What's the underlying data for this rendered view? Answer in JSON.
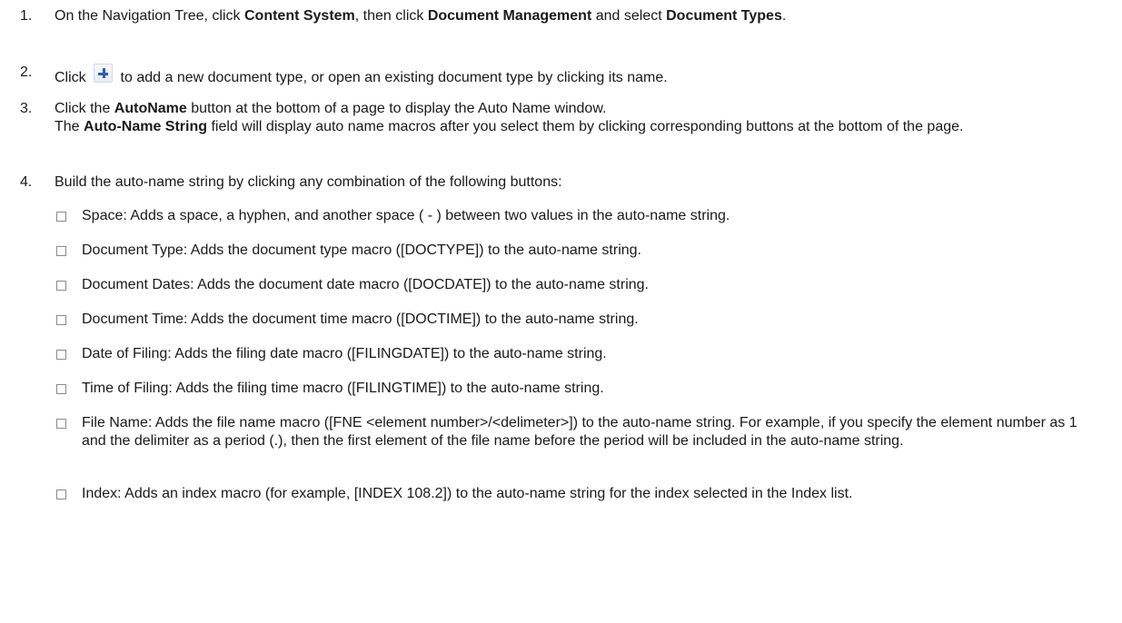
{
  "steps": [
    {
      "num": "1.",
      "t1": "On the Navigation Tree, click ",
      "b1": "Content System",
      "t2": ", then click ",
      "b2": "Document Management",
      "t3": " and select ",
      "b3": "Document Types",
      "t4": "."
    },
    {
      "num": "2.",
      "pre": "Click ",
      "icon": "plus-icon",
      "post": " to add a new document type, or open an existing document type by clicking its name."
    },
    {
      "num": "3.",
      "l1a": "Click the ",
      "l1b": "AutoName",
      "l1c": " button at the bottom of a page to display the Auto Name window.",
      "l2a": "The ",
      "l2b": "Auto-Name String",
      "l2c": " field will display auto name macros after you select them by clicking corresponding buttons at the bottom of the page."
    },
    {
      "num": "4.",
      "text": "Build the auto-name string by clicking any combination of the following buttons:"
    }
  ],
  "options": [
    "Space: Adds a space, a hyphen, and another space ( - ) between two values in the auto-name string.",
    "Document Type: Adds the document type macro ([DOCTYPE]) to the auto-name string.",
    "Document Dates: Adds the document date macro ([DOCDATE]) to the auto-name string.",
    "Document Time: Adds the document time macro ([DOCTIME]) to the auto-name string.",
    "Date of Filing: Adds the filing date macro ([FILINGDATE]) to the auto-name string.",
    "Time of Filing: Adds the filing time macro ([FILINGTIME]) to the auto-name string.",
    "File Name: Adds the file name macro ([FNE <element number>/<delimeter>]) to the auto-name string. For example, if you specify the element number as 1 and the delimiter as a period (.), then the first element of the file name before the period will be included in the auto-name string.",
    "Index: Adds an index macro (for example, [INDEX 108.2]) to the auto-name string for the index selected in the Index list."
  ]
}
